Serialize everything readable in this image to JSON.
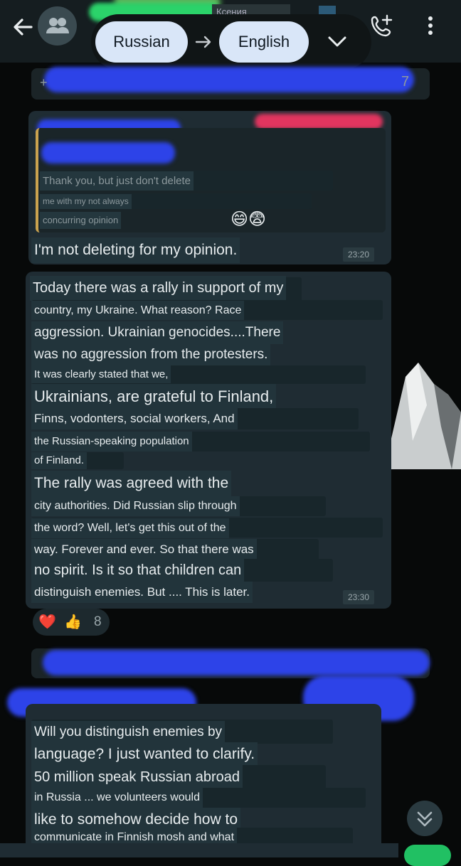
{
  "translate": {
    "from_lang": "Russian",
    "to_lang": "English"
  },
  "header": {
    "contact_name_partial": "Ксения"
  },
  "phone_bar": {
    "plus": "+",
    "suffix": "7"
  },
  "message1": {
    "quoted": [
      "Thank you, but just don't delete",
      "me with my not always",
      "concurring opinion"
    ],
    "quoted_emoji": "😄😨",
    "text": "I'm not deleting for my opinion.",
    "time": "23:20"
  },
  "message2": {
    "lines": [
      "Today there was a rally in support of my",
      "country, my Ukraine. What reason? Race",
      "aggression. Ukrainian genocides....There",
      "was no aggression from the protesters.",
      "It was clearly stated that we,",
      "Ukrainians, are grateful to Finland,",
      "Finns, vodonters, social workers, And",
      "the Russian-speaking population",
      "of Finland.",
      "The rally was agreed with the",
      "city authorities. Did Russian slip through",
      "the word? Well, let's get this out of the",
      "way. Forever and ever. So that there was",
      "no spirit. Is it so that children can",
      "distinguish enemies. But .... This is later."
    ],
    "time": "23:30"
  },
  "reactions": {
    "heart": "❤️",
    "thumbs": "👍",
    "count": "8"
  },
  "message3": {
    "lines": [
      "Will you distinguish enemies by",
      "language? I just wanted to clarify.",
      "50 million speak Russian abroad",
      "in Russia ... we volunteers would",
      "like to somehow decide how to",
      "communicate in Finnish mosh and what"
    ]
  },
  "icons": [
    "back-arrow-icon",
    "group-avatar-icon",
    "add-call-icon",
    "more-vert-icon",
    "arrow-right-icon",
    "chevron-down-icon",
    "double-chevron-down-icon"
  ],
  "colors": {
    "pill": "#d9e6f8",
    "bubble": "#1f2c33",
    "redaction_blue": "#2d43e8",
    "redaction_pink": "#e1355f",
    "accent_green": "#21c063"
  }
}
